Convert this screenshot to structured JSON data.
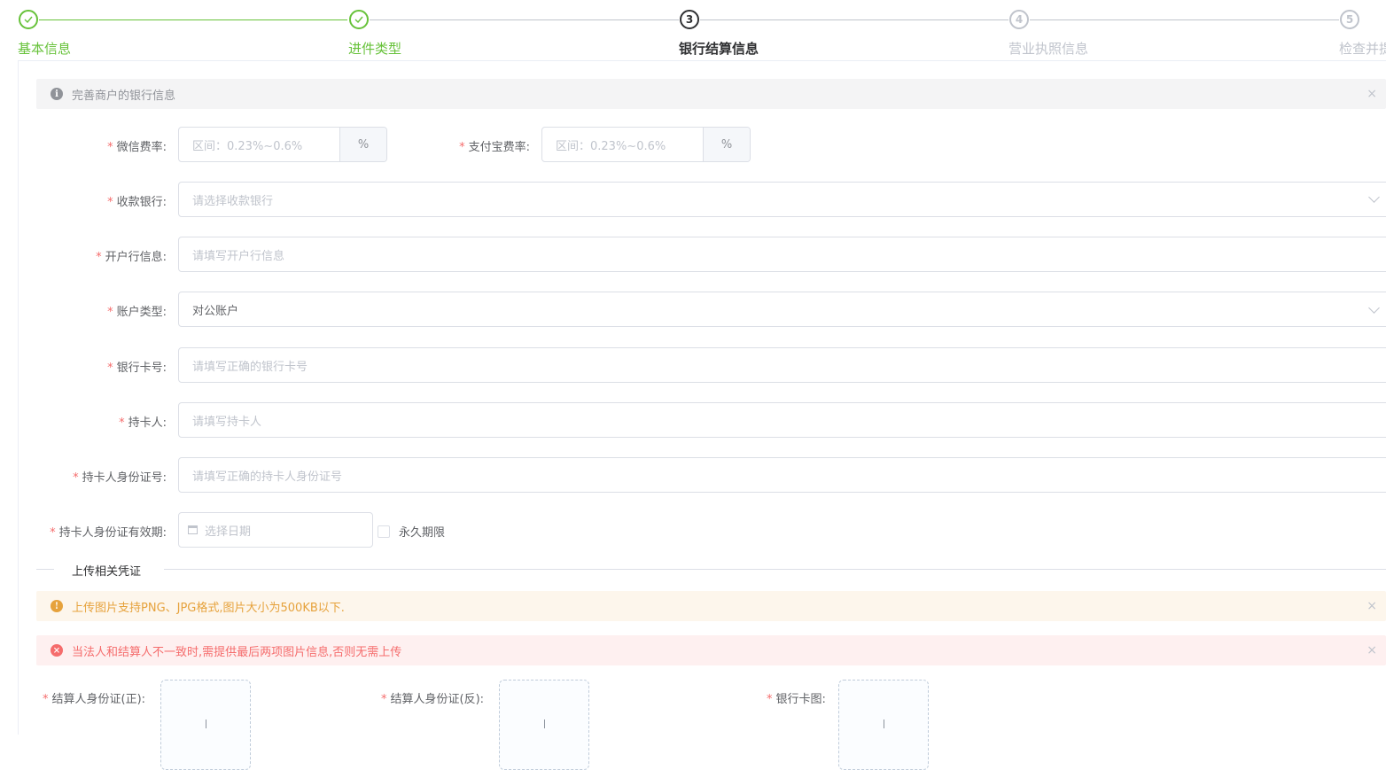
{
  "steps": [
    {
      "title": "基本信息",
      "status": "done",
      "icon": "check-icon"
    },
    {
      "title": "进件类型",
      "status": "done",
      "icon": "check-icon"
    },
    {
      "title": "银行结算信息",
      "status": "active",
      "number": "3"
    },
    {
      "title": "营业执照信息",
      "status": "wait",
      "number": "4"
    },
    {
      "title": "检查并提",
      "status": "wait",
      "number": "5"
    }
  ],
  "info_alert": {
    "text": "完善商户的银行信息",
    "close": "×"
  },
  "rates": {
    "wechat_label": "微信费率:",
    "wechat_placeholder": "区间：0.23%~0.6%",
    "alipay_label": "支付宝费率:",
    "alipay_placeholder": "区间：0.23%~0.6%",
    "unit": "%"
  },
  "fields": {
    "bank_label": "收款银行:",
    "bank_placeholder": "请选择收款银行",
    "branch_label": "开户行信息:",
    "branch_placeholder": "请填写开户行信息",
    "account_type_label": "账户类型:",
    "account_type_value": "对公账户",
    "card_no_label": "银行卡号:",
    "card_no_placeholder": "请填写正确的银行卡号",
    "holder_label": "持卡人:",
    "holder_placeholder": "请填写持卡人",
    "holder_id_label": "持卡人身份证号:",
    "holder_id_placeholder": "请填写正确的持卡人身份证号",
    "id_expiry_label": "持卡人身份证有效期:",
    "id_expiry_placeholder": "选择日期",
    "permanent_label": "永久期限",
    "required_mark": "*"
  },
  "upload_section": {
    "divider_title": "上传相关凭证",
    "warning_text": "上传图片支持PNG、JPG格式,图片大小为500KB以下.",
    "error_text": "当法人和结算人不一致时,需提供最后两项图片信息,否则无需上传",
    "close": "×",
    "id_front_label": "结算人身份证(正):",
    "id_back_label": "结算人身份证(反):",
    "bank_card_label": "银行卡图:"
  },
  "colors": {
    "success": "#67c23a",
    "active": "#303133",
    "wait": "#c0c4cc",
    "required": "#f56c6c",
    "warning": "#e6a23c",
    "error": "#f56c6c"
  }
}
